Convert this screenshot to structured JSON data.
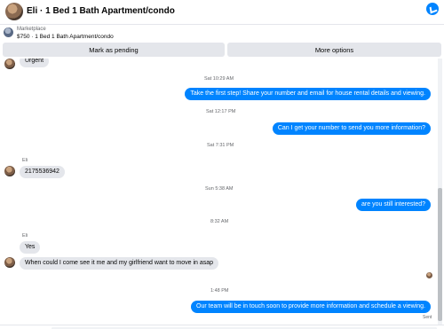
{
  "header": {
    "title": "Eli · 1 Bed 1 Bath Apartment/condo"
  },
  "marketplace": {
    "label": "Marketplace",
    "item": "$750 · 1 Bed 1 Bath Apartment/condo"
  },
  "actions": {
    "mark_pending": "Mark as pending",
    "more_options": "More options"
  },
  "thread": {
    "messages": [
      {
        "type": "in",
        "text": "Urgent"
      },
      {
        "type": "time",
        "text": "Sat 10:29 AM"
      },
      {
        "type": "out",
        "text": "Take the first step! Share your number and email for house rental details and viewing."
      },
      {
        "type": "time",
        "text": "Sat 12:17 PM"
      },
      {
        "type": "out",
        "text": "Can I get your number to send you more information?"
      },
      {
        "type": "time",
        "text": "Sat 7:31 PM"
      },
      {
        "type": "sender",
        "text": "Eli"
      },
      {
        "type": "in",
        "text": "2175536942"
      },
      {
        "type": "time",
        "text": "Sun 5:38 AM"
      },
      {
        "type": "out",
        "text": "are you still interested?"
      },
      {
        "type": "time",
        "text": "8:32 AM"
      },
      {
        "type": "sender",
        "text": "Eli"
      },
      {
        "type": "in",
        "text": "Yes"
      },
      {
        "type": "in",
        "text": "When could I come see it me and my girlfriend want to move in asap"
      },
      {
        "type": "time",
        "text": "1:48 PM"
      },
      {
        "type": "out",
        "text": "Our team will be in touch soon to provide more information and schedule a viewing."
      },
      {
        "type": "status",
        "text": "Sent"
      }
    ]
  },
  "icons": {
    "header_avatar": "avatar-photo",
    "chevron": "chevron-down-icon",
    "logo": "messenger-icon",
    "listing_thumb": "listing-thumbnail"
  },
  "colors": {
    "accent": "#0084ff",
    "incoming": "#e4e6eb",
    "button": "#e4e6eb"
  }
}
